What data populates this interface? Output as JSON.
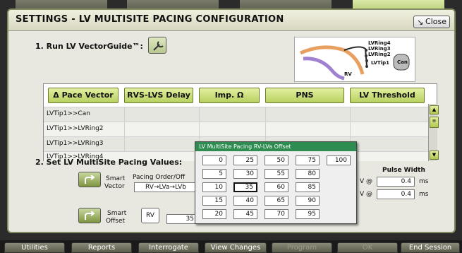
{
  "dialog": {
    "title": "SETTINGS - LV MULTISITE PACING CONFIGURATION",
    "close_label": "Close"
  },
  "step1": {
    "label": "1. Run LV VectorGuide™:"
  },
  "heart_image": {
    "labels": [
      "LVRing4",
      "LVRing3",
      "LVRing2",
      "LVTip1",
      "Can",
      "RV"
    ]
  },
  "table": {
    "columns": [
      "Δ Pace Vector",
      "RVS-LVS Delay",
      "Imp. Ω",
      "PNS",
      "LV Threshold"
    ],
    "rows": [
      "LVTip1>>Can",
      "LVTip1>>LVRing2",
      "LVTip1>>LVRing3",
      "LVTip1>>LVRing4"
    ]
  },
  "step2": {
    "label": "2. Set LV MultiSite Pacing Values:"
  },
  "smart_vector": {
    "label_line1": "Smart",
    "label_line2": "Vector",
    "pacing_order_label": "Pacing Order/Off",
    "pacing_order_value": "RV→LVa→LVb"
  },
  "smart_offset": {
    "label_line1": "Smart",
    "label_line2": "Offset",
    "rv_label": "RV",
    "offset_value": "35"
  },
  "pulse_width": {
    "label": "Pulse Width",
    "row1_prefix": "V @",
    "row1_value": "0.4",
    "row1_unit": "ms",
    "row2_prefix": "V @",
    "row2_value": "0.4",
    "row2_unit": "ms"
  },
  "popup": {
    "title": "LV MultiSite Pacing RV-LVa Offset",
    "values": [
      [
        "0",
        "25",
        "50",
        "75",
        "100"
      ],
      [
        "5",
        "30",
        "55",
        "80"
      ],
      [
        "10",
        "35",
        "60",
        "85"
      ],
      [
        "15",
        "40",
        "65",
        "90"
      ],
      [
        "20",
        "45",
        "70",
        "95"
      ]
    ],
    "selected": "35"
  },
  "bottom_bar": {
    "buttons": [
      "Utilities",
      "Reports",
      "Interrogate",
      "View Changes",
      "Program",
      "OK",
      "End Session"
    ]
  },
  "colors": {
    "accent_green": "#b8d060",
    "popup_title_bg": "#2e8c50"
  }
}
